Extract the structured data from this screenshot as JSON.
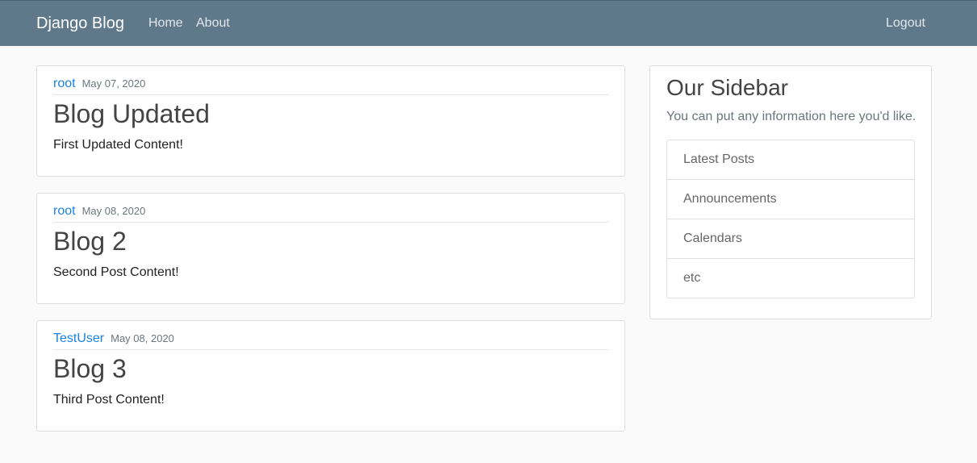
{
  "navbar": {
    "brand": "Django Blog",
    "links": [
      "Home",
      "About"
    ],
    "logout": "Logout"
  },
  "posts": [
    {
      "author": "root",
      "date": "May 07, 2020",
      "title": "Blog Updated",
      "content": "First Updated Content!"
    },
    {
      "author": "root",
      "date": "May 08, 2020",
      "title": "Blog 2",
      "content": "Second Post Content!"
    },
    {
      "author": "TestUser",
      "date": "May 08, 2020",
      "title": "Blog 3",
      "content": "Third Post Content!"
    }
  ],
  "sidebar": {
    "title": "Our Sidebar",
    "text": "You can put any information here you'd like.",
    "items": [
      "Latest Posts",
      "Announcements",
      "Calendars",
      "etc"
    ]
  },
  "colors": {
    "navbar": "#5f788a",
    "link": "#1a82e2",
    "background": "#fafafa"
  }
}
